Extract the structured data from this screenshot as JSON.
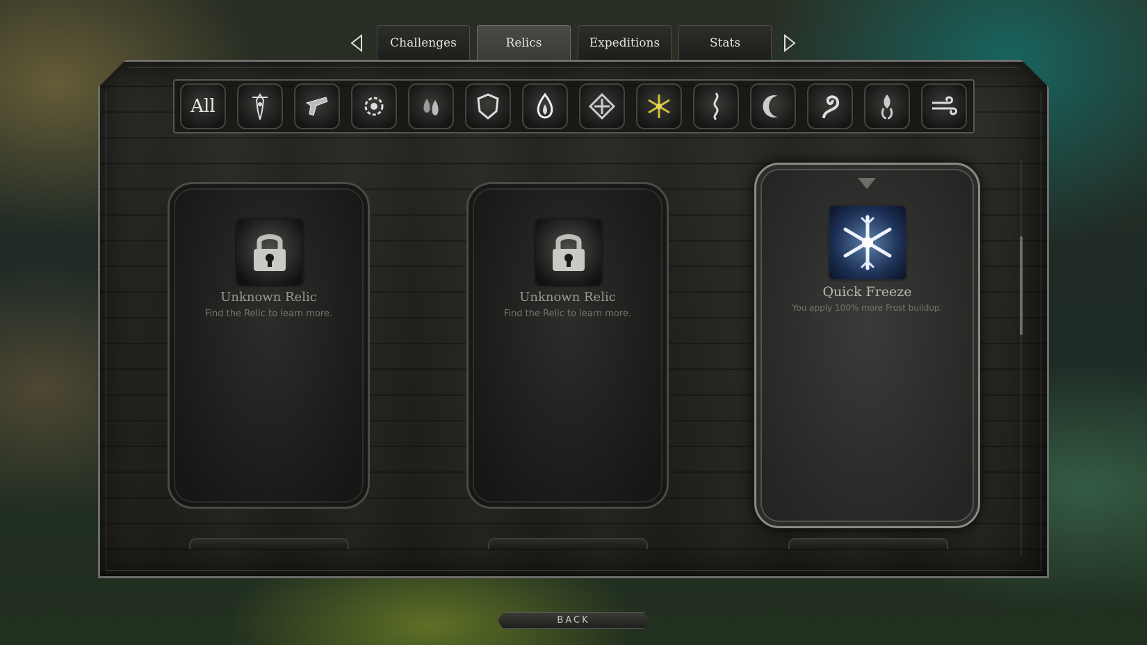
{
  "nav": {
    "tabs": [
      {
        "label": "Challenges",
        "active": false
      },
      {
        "label": "Relics",
        "active": true
      },
      {
        "label": "Expeditions",
        "active": false
      },
      {
        "label": "Stats",
        "active": false
      }
    ],
    "prev_icon": "chevron-left-icon",
    "next_icon": "chevron-right-icon"
  },
  "filters": {
    "all_label": "All",
    "icons": [
      "figure-icon",
      "pistol-icon",
      "gear-emblem-icon",
      "fire-drops-icon",
      "shield-icon",
      "flame-icon",
      "cross-arrows-icon",
      "frost-star-icon",
      "spiral-blade-icon",
      "moon-icon",
      "tentacle-icon",
      "spirit-icon",
      "wind-icon"
    ]
  },
  "relics": [
    {
      "title": "Unknown Relic",
      "description": "Find the Relic to learn more.",
      "locked": true,
      "icon": "lock-icon"
    },
    {
      "title": "Unknown Relic",
      "description": "Find the Relic to learn more.",
      "locked": true,
      "icon": "lock-icon"
    },
    {
      "title": "Quick Freeze",
      "description": "You apply 100% more Frost buildup.",
      "locked": false,
      "icon": "snowflake-icon"
    }
  ],
  "footer": {
    "back_label": "BACK"
  },
  "colors": {
    "accent_text": "#e6e3da",
    "frost_blue": "#5d7fa8",
    "frame": "#6d6d6b"
  }
}
